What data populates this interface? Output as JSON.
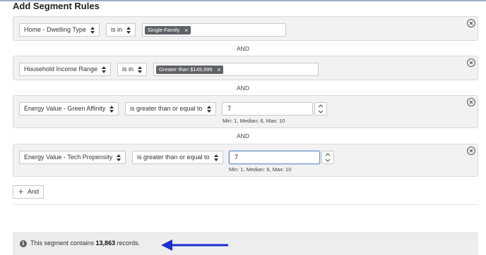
{
  "page": {
    "title": "Add Segment Rules"
  },
  "rules": [
    {
      "field": "Home - Dwelling Type",
      "operator": "is in",
      "tag": "Single-Family"
    },
    {
      "field": "Household Income Range",
      "operator": "is in",
      "tag": "Greater than $149,999"
    },
    {
      "field": "Energy Value - Green Affinity",
      "operator": "is greater than or equal to",
      "value": "7",
      "hint": "Min: 1, Median: 6, Max: 10"
    },
    {
      "field": "Energy Value - Tech Propensity",
      "operator": "is greater than or equal to",
      "value": "7",
      "hint": "Min: 1, Median: 6, Max: 10"
    }
  ],
  "connector": "AND",
  "add_button": {
    "label": "And"
  },
  "summary": {
    "prefix": "This segment contains ",
    "count": "13,863",
    "suffix": " records."
  },
  "colors": {
    "tag": "#5f6368",
    "arrow": "#1c2fd1",
    "focus": "#6a93c8"
  },
  "icons": [
    "close-circle-icon",
    "sort-arrows-icon",
    "remove-tag-icon",
    "spinner-arrows-icon",
    "plus-icon",
    "info-icon",
    "arrow-left-icon"
  ]
}
